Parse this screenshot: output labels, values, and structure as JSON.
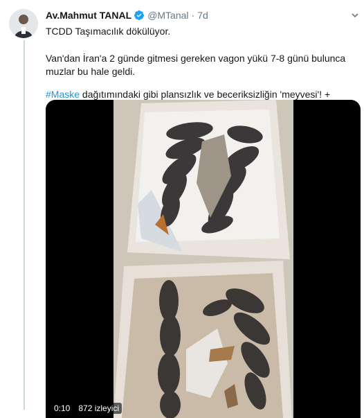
{
  "tweet": {
    "author_name": "Av.Mahmut TANAL",
    "handle": "@MTanal",
    "separator": "·",
    "time": "7d",
    "paragraph_1": "TCDD Taşımacılık dökülüyor.",
    "paragraph_2": "Van'dan İran'a 2 günde gitmesi gereken vagon yükü 7-8 günü bulunca muzlar bu hale geldi.",
    "hashtag": "#Maske",
    "paragraph_3_rest": " dağıtımındaki gibi plansızlık ve beceriksizliğin 'meyvesi'! +",
    "video": {
      "duration": "0:10",
      "views": "872 izleyici"
    }
  },
  "icons": {
    "verified": "verified-badge-icon",
    "caret": "chevron-down-icon"
  },
  "colors": {
    "link": "#1b95e0",
    "secondary_text": "#657786",
    "verified": "#1da1f2"
  }
}
